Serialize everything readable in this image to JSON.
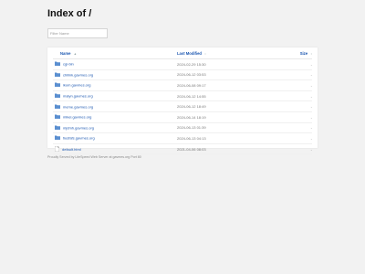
{
  "page": {
    "title": "Index of /"
  },
  "filter": {
    "placeholder": "Filter Name"
  },
  "table": {
    "headers": {
      "name": "Name",
      "modified": "Last Modified",
      "size": "Size"
    },
    "sort_arrows": {
      "name": "▲",
      "modified": "↕",
      "size": "↕"
    },
    "rows": [
      {
        "name": "cgi-bin",
        "modified": "2024-02-29 15:30",
        "size": "-",
        "type": "folder"
      },
      {
        "name": "chilink.gavmes.org",
        "modified": "2024-06-12 03:53",
        "size": "-",
        "type": "folder"
      },
      {
        "name": "ikom.gavmes.org",
        "modified": "2024-06-08 09:17",
        "size": "-",
        "type": "folder"
      },
      {
        "name": "malyn.gavmes.org",
        "modified": "2024-06-12 14:55",
        "size": "-",
        "type": "folder"
      },
      {
        "name": "meme.gavmes.org",
        "modified": "2024-06-12 18:49",
        "size": "-",
        "type": "folder"
      },
      {
        "name": "mikei.gavmes.org",
        "modified": "2024-06-14 18:19",
        "size": "-",
        "type": "folder"
      },
      {
        "name": "mjdmh.gavmes.org",
        "modified": "2024-06-13 01:39",
        "size": "-",
        "type": "folder"
      },
      {
        "name": "tiusfafs.gavmes.org",
        "modified": "2024-06-13 04:13",
        "size": "-",
        "type": "folder"
      },
      {
        "name": "default.html",
        "modified": "2021-04-06 08:03",
        "size": "-",
        "type": "file"
      }
    ]
  },
  "footer": {
    "text": "Proudly Served by LiteSpeed Web Server at gavmes.org Port 80"
  },
  "colors": {
    "link": "#1a56b0",
    "folder": "#5b8fd0",
    "background": "#f2f2f2"
  },
  "icons": {
    "folder": "folder-icon",
    "file": "file-icon"
  }
}
